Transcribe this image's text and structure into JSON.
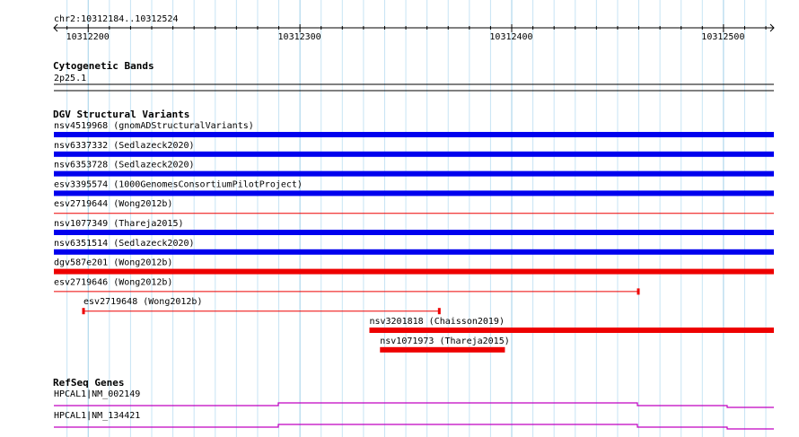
{
  "ruler": {
    "region": "chr2:10312184..10312524",
    "start": 10312184,
    "end": 10312524,
    "ticks": [
      "10312200",
      "10312300",
      "10312400",
      "10312500"
    ]
  },
  "tracks": {
    "cytoband": {
      "title": "Cytogenetic Bands",
      "band": "2p25.1"
    },
    "dgv": {
      "title": "DGV Structural Variants",
      "features": [
        {
          "label": "nsv4519968 (gnomADStructuralVariants)",
          "start": 10312184,
          "end": 10312524,
          "color": "#0000ee",
          "style": "thick"
        },
        {
          "label": "nsv6337332 (Sedlazeck2020)",
          "start": 10312184,
          "end": 10312524,
          "color": "#0000ee",
          "style": "thick"
        },
        {
          "label": "nsv6353728 (Sedlazeck2020)",
          "start": 10312184,
          "end": 10312524,
          "color": "#0000ee",
          "style": "thick"
        },
        {
          "label": "esv3395574 (1000GenomesConsortiumPilotProject)",
          "start": 10312184,
          "end": 10312524,
          "color": "#0000ee",
          "style": "thick"
        },
        {
          "label": "esv2719644 (Wong2012b)",
          "start": 10312184,
          "end": 10312524,
          "color": "#ee0000",
          "style": "thin"
        },
        {
          "label": "nsv1077349 (Thareja2015)",
          "start": 10312184,
          "end": 10312524,
          "color": "#0000ee",
          "style": "thick"
        },
        {
          "label": "nsv6351514 (Sedlazeck2020)",
          "start": 10312184,
          "end": 10312524,
          "color": "#0000ee",
          "style": "thick"
        },
        {
          "label": "dgv587e201 (Wong2012b)",
          "start": 10312184,
          "end": 10312524,
          "color": "#ee0000",
          "style": "thick"
        },
        {
          "label": "esv2719646 (Wong2012b)",
          "start": 10312184,
          "end": 10312460,
          "color": "#ee0000",
          "style": "thin"
        },
        {
          "label": "esv2719648 (Wong2012b)",
          "start": 10312198,
          "end": 10312366,
          "color": "#ee0000",
          "style": "thin"
        },
        {
          "label": "nsv3201818 (Chaisson2019)",
          "start": 10312333,
          "end": 10312524,
          "color": "#ee0000",
          "style": "thick"
        },
        {
          "label": "nsv1071973 (Thareja2015)",
          "start": 10312338,
          "end": 10312397,
          "color": "#ee0000",
          "style": "thick"
        }
      ]
    },
    "refseq": {
      "title": "RefSeq Genes",
      "color": "#c000c0",
      "genes": [
        {
          "label": "HPCAL1|NM_002149"
        },
        {
          "label": "HPCAL1|NM_134421"
        }
      ]
    }
  }
}
